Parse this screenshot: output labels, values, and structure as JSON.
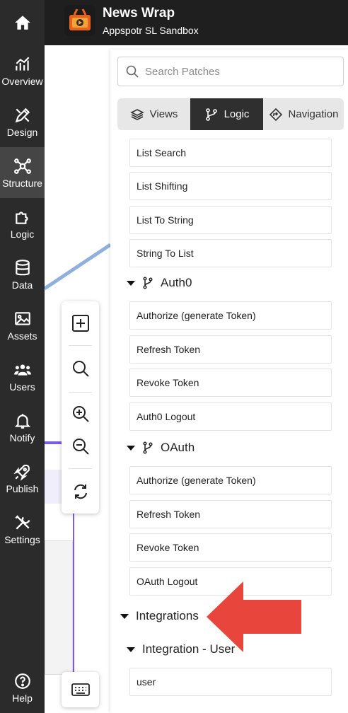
{
  "app": {
    "title": "News Wrap",
    "subtitle": "Appspotr SL Sandbox"
  },
  "nav": {
    "home_icon": "home-icon",
    "items": [
      {
        "label": "Overview",
        "icon": "chart-icon"
      },
      {
        "label": "Design",
        "icon": "design-icon"
      },
      {
        "label": "Structure",
        "icon": "structure-icon",
        "active": true
      },
      {
        "label": "Logic",
        "icon": "puzzle-icon"
      },
      {
        "label": "Data",
        "icon": "database-icon"
      },
      {
        "label": "Assets",
        "icon": "image-icon"
      },
      {
        "label": "Users",
        "icon": "users-icon"
      },
      {
        "label": "Notify",
        "icon": "bell-icon"
      },
      {
        "label": "Publish",
        "icon": "rocket-icon"
      },
      {
        "label": "Settings",
        "icon": "tools-icon"
      }
    ],
    "help": {
      "label": "Help",
      "icon": "help-icon"
    }
  },
  "panel": {
    "search_placeholder": "Search Patches",
    "tabs": [
      {
        "label": "Views",
        "icon": "layers-icon"
      },
      {
        "label": "Logic",
        "icon": "branch-icon",
        "selected": true
      },
      {
        "label": "Navigation",
        "icon": "navigation-icon"
      }
    ],
    "list_items_top": [
      "List Search",
      "List Shifting",
      "List To String",
      "String To List"
    ],
    "auth0": {
      "title": "Auth0",
      "items": [
        "Authorize (generate Token)",
        "Refresh Token",
        "Revoke Token",
        "Auth0 Logout"
      ]
    },
    "oauth": {
      "title": "OAuth",
      "items": [
        "Authorize (generate Token)",
        "Refresh Token",
        "Revoke Token",
        "OAuth Logout"
      ]
    },
    "integrations": {
      "title": "Integrations",
      "subgroup": "Integration - User",
      "items": [
        "user"
      ]
    }
  },
  "colors": {
    "nav_bg": "#2b2b2b",
    "header_bg": "#1f1f1f",
    "tab_selected": "#2f2f2f",
    "annotation_arrow": "#e8453c",
    "connector_line": "#8fb0dc",
    "purple_line": "#7b5ce6"
  }
}
